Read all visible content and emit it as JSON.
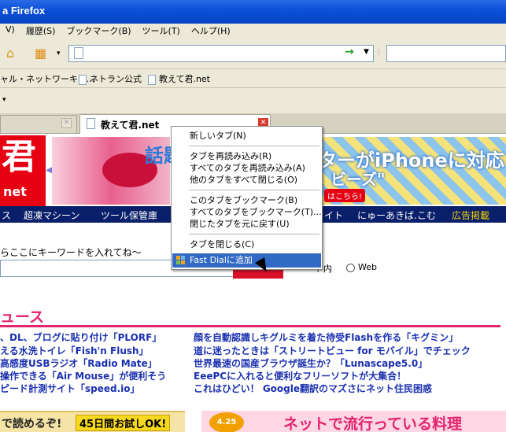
{
  "window": {
    "title": "a Firefox"
  },
  "menu": [
    "V)",
    "履歴(S)",
    "ブックマーク(B)",
    "ツール(T)",
    "ヘルプ(H)"
  ],
  "bookmarks": [
    "ャル・ネットワーキン...",
    "ネトラン公式",
    "教えて君.net"
  ],
  "tabs": {
    "active_title": "教えて君.net"
  },
  "banner": {
    "logo_main": "君",
    "logo_sub": "net",
    "ad_text_left": "話題",
    "ad_text_right_1": "ターがiPhoneに対応",
    "ad_text_right_2": "ビーズ\"",
    "ad_text_right_3": "はこちら!"
  },
  "categories": [
    "ス",
    "超凍マシーン",
    "ツール保管庫",
    "イト",
    "にゅーあきば.こむ",
    "広告掲載"
  ],
  "search": {
    "keyword_hint": "らここにキーワードを入れてね～",
    "radio_site": "ト内",
    "radio_web": "Web"
  },
  "news": {
    "heading": "ュース",
    "left": [
      "、DL、ブログに貼り付け「PLORF」",
      "える水洗トイレ「Fish'n Flush」",
      "高感度USBラジオ「Radio Mate」",
      "操作できる「Air Mouse」が便利そう",
      "ピード計測サイト「speed.io」"
    ],
    "right": [
      "顔を自動認識しキグルミを着た待受Flashを作る「キグミン」",
      "道に迷ったときは「ストリートビュー for モバイル」でチェック",
      "世界最速の国産ブラウザ誕生か？「Lunascape5.0」",
      "EeePCに入れると便利なフリーソフトが大集合！",
      "これはひどい！ Google翻訳のマズさにネット住民困惑"
    ]
  },
  "ads_bottom": {
    "left_text": "で読めるぞ!",
    "left_badge": "45日間お試しOK!",
    "right_badge": "4.25",
    "right_text": "ネットで流行っている料理"
  },
  "context_menu": [
    "新しいタブ(N)",
    "タブを再読み込み(R)",
    "すべてのタブを再読み込み(A)",
    "他のタブをすべて閉じる(O)",
    "このタブをブックマーク(B)",
    "すべてのタブをブックマーク(T)...",
    "閉じたタブを元に戻す(U)",
    "タブを閉じる(C)",
    "Fast Dialに追加"
  ]
}
